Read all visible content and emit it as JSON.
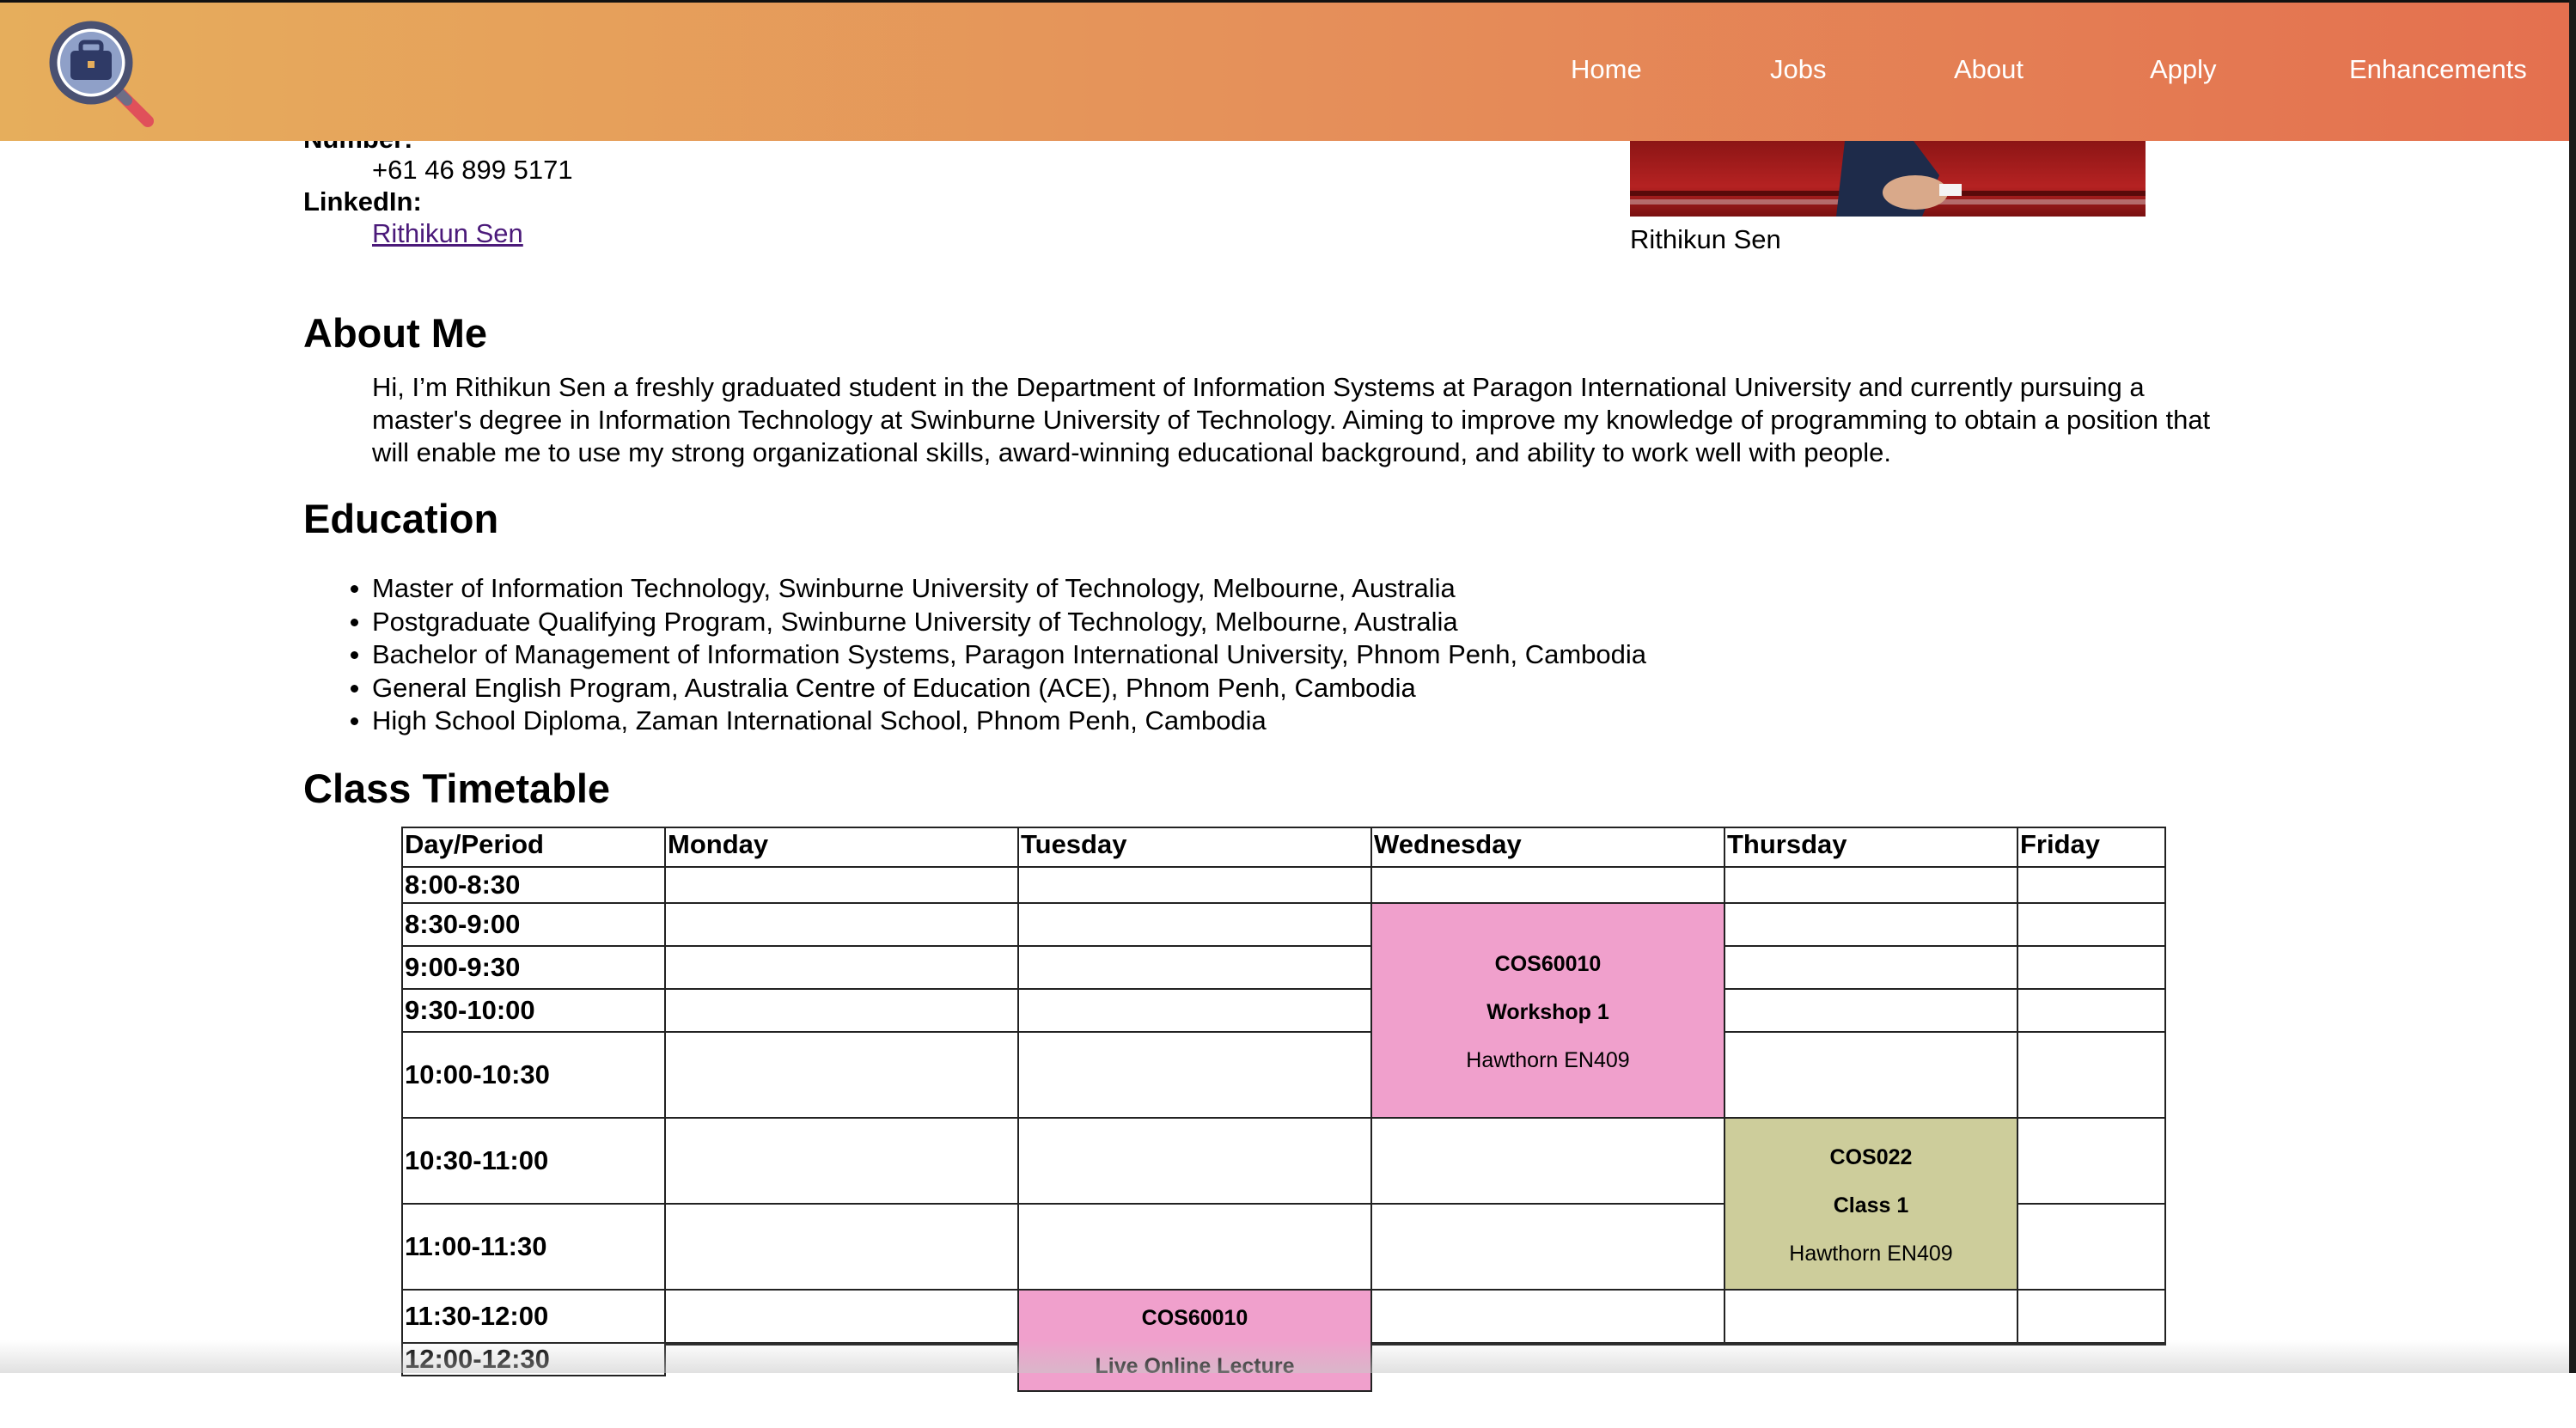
{
  "nav": {
    "items": [
      "Home",
      "Jobs",
      "About",
      "Apply",
      "Enhancements"
    ]
  },
  "contact": {
    "number_label": "Number:",
    "number": "+61 46 899 5171",
    "linkedin_label": "LinkedIn:",
    "linkedin_link": "Rithikun Sen"
  },
  "photo": {
    "caption": "Rithikun Sen"
  },
  "about": {
    "heading": "About Me",
    "text": "Hi, I’m Rithikun Sen a freshly graduated student in the Department of Information Systems at Paragon International University and currently pursuing a master's degree in Information Technology at Swinburne University of Technology. Aiming to improve my knowledge of programming to obtain a position that will enable me to use my strong organizational skills, award-winning educational background, and ability to work well with people."
  },
  "education": {
    "heading": "Education",
    "items": [
      "Master of Information Technology, Swinburne University of Technology, Melbourne, Australia",
      "Postgraduate Qualifying Program, Swinburne University of Technology, Melbourne, Australia",
      "Bachelor of Management of Information Systems, Paragon International University, Phnom Penh, Cambodia",
      "General English Program, Australia Centre of Education (ACE), Phnom Penh, Cambodia",
      "High School Diploma, Zaman International School, Phnom Penh, Cambodia"
    ]
  },
  "timetable": {
    "heading": "Class Timetable",
    "headers": [
      "Day/Period",
      "Monday",
      "Tuesday",
      "Wednesday",
      "Thursday",
      "Friday"
    ],
    "periods": [
      "8:00-8:30",
      "8:30-9:00",
      "9:00-9:30",
      "9:30-10:00",
      "10:00-10:30",
      "10:30-11:00",
      "11:00-11:30",
      "11:30-12:00",
      "12:00-12:30"
    ],
    "blocks": [
      {
        "day": "Wednesday",
        "code": "COS60010",
        "type": "Workshop 1",
        "location": "Hawthorn EN409",
        "color": "#f0a0cc"
      },
      {
        "day": "Thursday",
        "code": "COS022",
        "type": "Class 1",
        "location": "Hawthorn EN409",
        "color": "#cdcd9b"
      },
      {
        "day": "Tuesday",
        "code": "COS60010",
        "type": "Live Online Lecture",
        "location": "",
        "color": "#f0a0cc"
      }
    ]
  },
  "colors": {
    "header_start": "#e6ae5c",
    "header_end": "#e4704f",
    "link": "#4b1a7a"
  }
}
